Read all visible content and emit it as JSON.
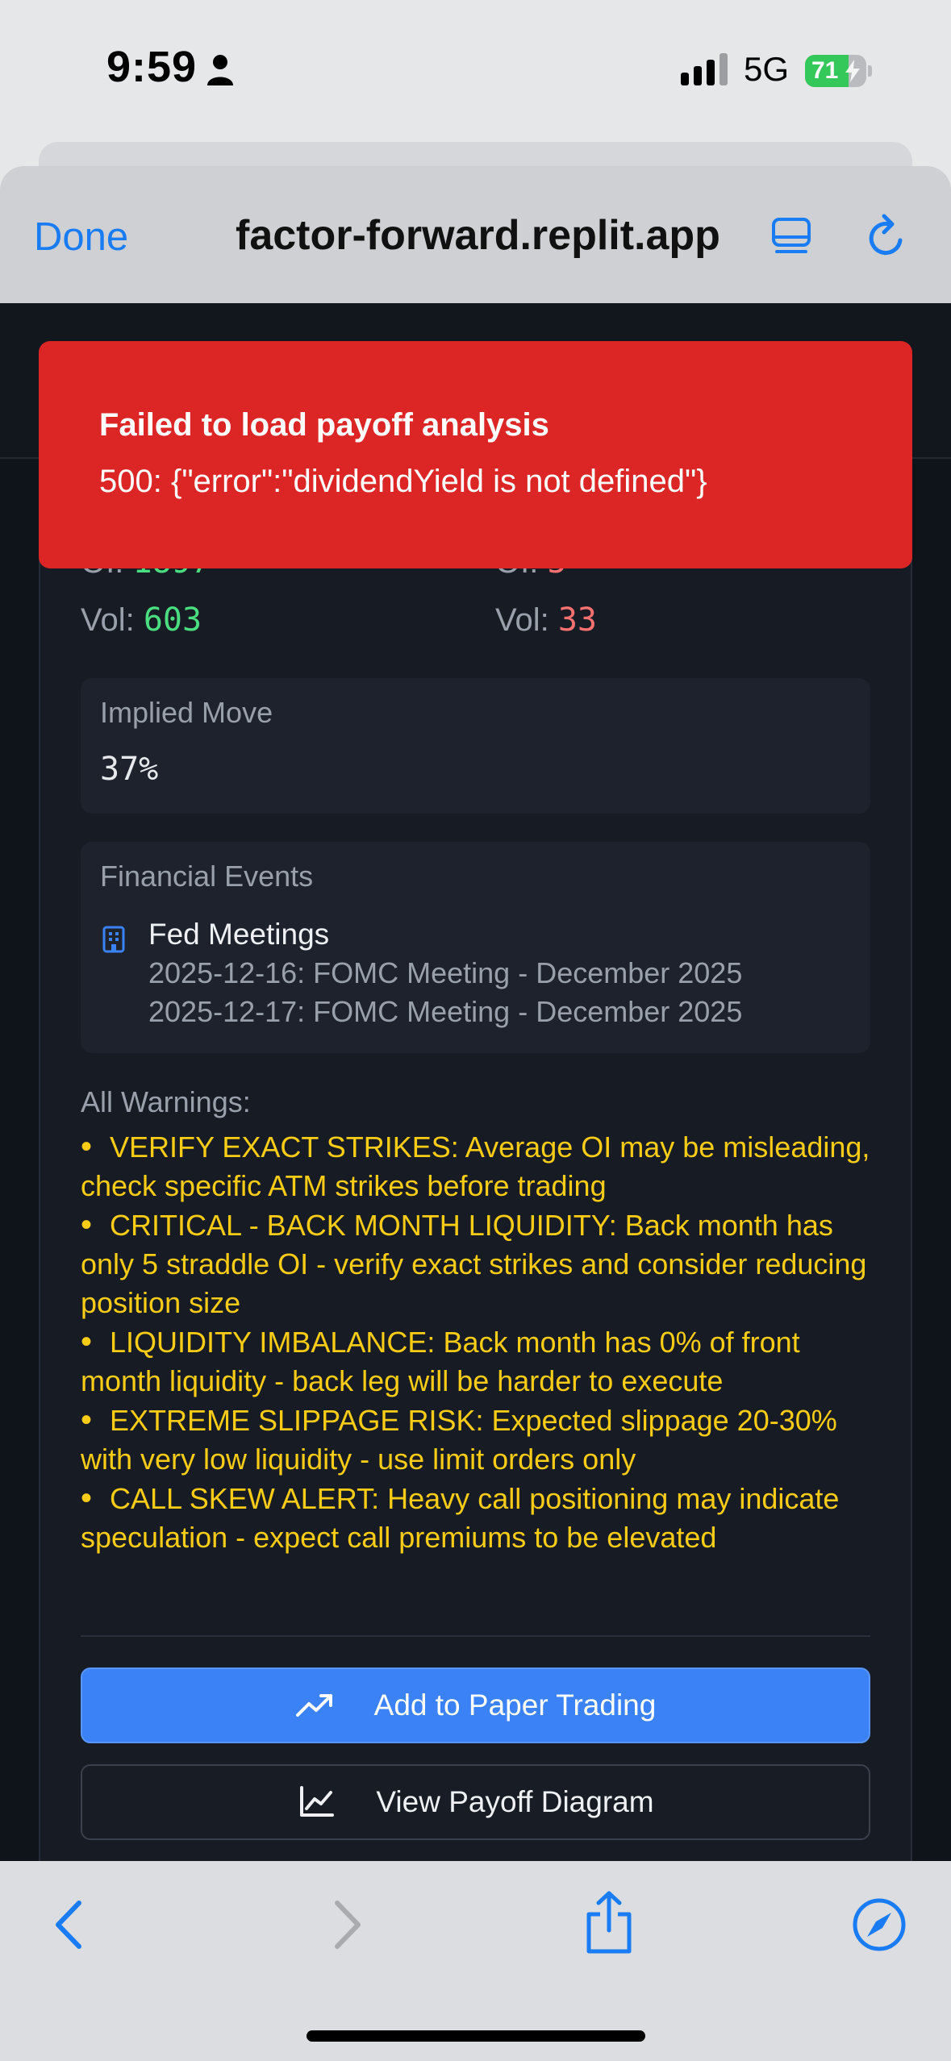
{
  "status_bar": {
    "time": "9:59",
    "network": "5G",
    "battery_percent": "71",
    "battery_level": 0.71,
    "icons": [
      "person-icon",
      "signal-icon",
      "battery-charging-icon"
    ]
  },
  "browser": {
    "done_label": "Done",
    "url": "factor-forward.replit.app",
    "icons": [
      "reader-icon",
      "reload-icon"
    ]
  },
  "toast": {
    "title": "Failed to load payoff analysis",
    "message": "500: {\"error\":\"dividendYield is not defined\"}"
  },
  "liquidity": {
    "front": {
      "oi_label": "OI:",
      "oi_value": "1897",
      "vol_label": "Vol:",
      "vol_value": "603"
    },
    "back": {
      "oi_label": "OI:",
      "oi_value": "5",
      "vol_label": "Vol:",
      "vol_value": "33"
    }
  },
  "implied_move": {
    "label": "Implied Move",
    "value": "37%"
  },
  "financial_events": {
    "title": "Financial Events",
    "category": "Fed Meetings",
    "icon": "building-icon",
    "items": [
      "2025-12-16: FOMC Meeting - December 2025",
      "2025-12-17: FOMC Meeting - December 2025"
    ]
  },
  "warnings": {
    "title": "All Warnings:",
    "items": [
      "VERIFY EXACT STRIKES: Average OI may be misleading, check specific ATM strikes before trading",
      "CRITICAL - BACK MONTH LIQUIDITY: Back month has only 5 straddle OI - verify exact strikes and consider reducing position size",
      "LIQUIDITY IMBALANCE: Back month has 0% of front month liquidity - back leg will be harder to execute",
      "EXTREME SLIPPAGE RISK: Expected slippage 20-30% with very low liquidity - use limit orders only",
      "CALL SKEW ALERT: Heavy call positioning may indicate speculation - expect call premiums to be elevated"
    ]
  },
  "actions": {
    "paper_trading_label": "Add to Paper Trading",
    "payoff_label": "View Payoff Diagram"
  },
  "toolbar": {
    "icons": [
      "back-icon",
      "forward-icon",
      "share-icon",
      "compass-icon"
    ]
  },
  "colors": {
    "toast_bg": "#dc2626",
    "accent": "#3b82f6",
    "warning": "#facc15",
    "positive": "#4ade80",
    "negative": "#f87171"
  }
}
